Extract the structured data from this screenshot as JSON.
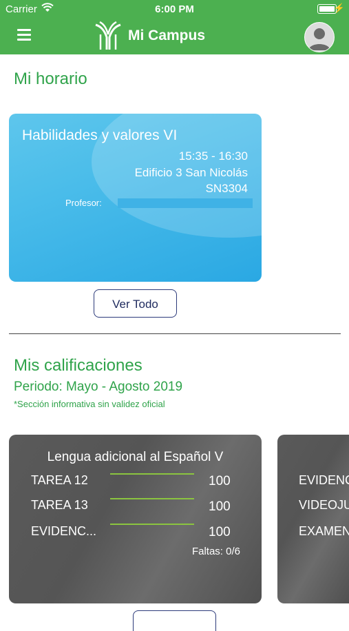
{
  "status_bar": {
    "carrier": "Carrier",
    "time": "6:00 PM"
  },
  "header": {
    "title": "Mi Campus",
    "menu_icon": "hamburger-menu-icon",
    "avatar_icon": "user-avatar-icon",
    "color": "#4cb050"
  },
  "schedule": {
    "heading": "Mi horario",
    "card": {
      "subject": "Habilidades y valores VI",
      "time": "15:35 - 16:30",
      "building": "Edificio 3 San Nicolás",
      "room": "SN3304",
      "professor_label": "Profesor:",
      "professor_name": ""
    },
    "view_all_label": "Ver Todo"
  },
  "grades": {
    "heading": "Mis calificaciones",
    "period": "Periodo: Mayo - Agosto 2019",
    "note": "*Sección informativa sin validez oficial",
    "cards": [
      {
        "course": "Lengua adicional al Español V",
        "items": [
          {
            "name": "TAREA 12",
            "score": "100"
          },
          {
            "name": "TAREA 13",
            "score": "100"
          },
          {
            "name": "EVIDENC...",
            "score": "100"
          }
        ],
        "absences": "Faltas: 0/6"
      },
      {
        "items": [
          {
            "name": "EVIDENC"
          },
          {
            "name": "VIDEOJU"
          },
          {
            "name": "EXAMEN"
          }
        ]
      }
    ]
  },
  "colors": {
    "accent_green": "#2fa34a",
    "card_blue": "#3cb6e8",
    "bar_green": "#8bc53f",
    "button_border": "#2c3a7a"
  }
}
